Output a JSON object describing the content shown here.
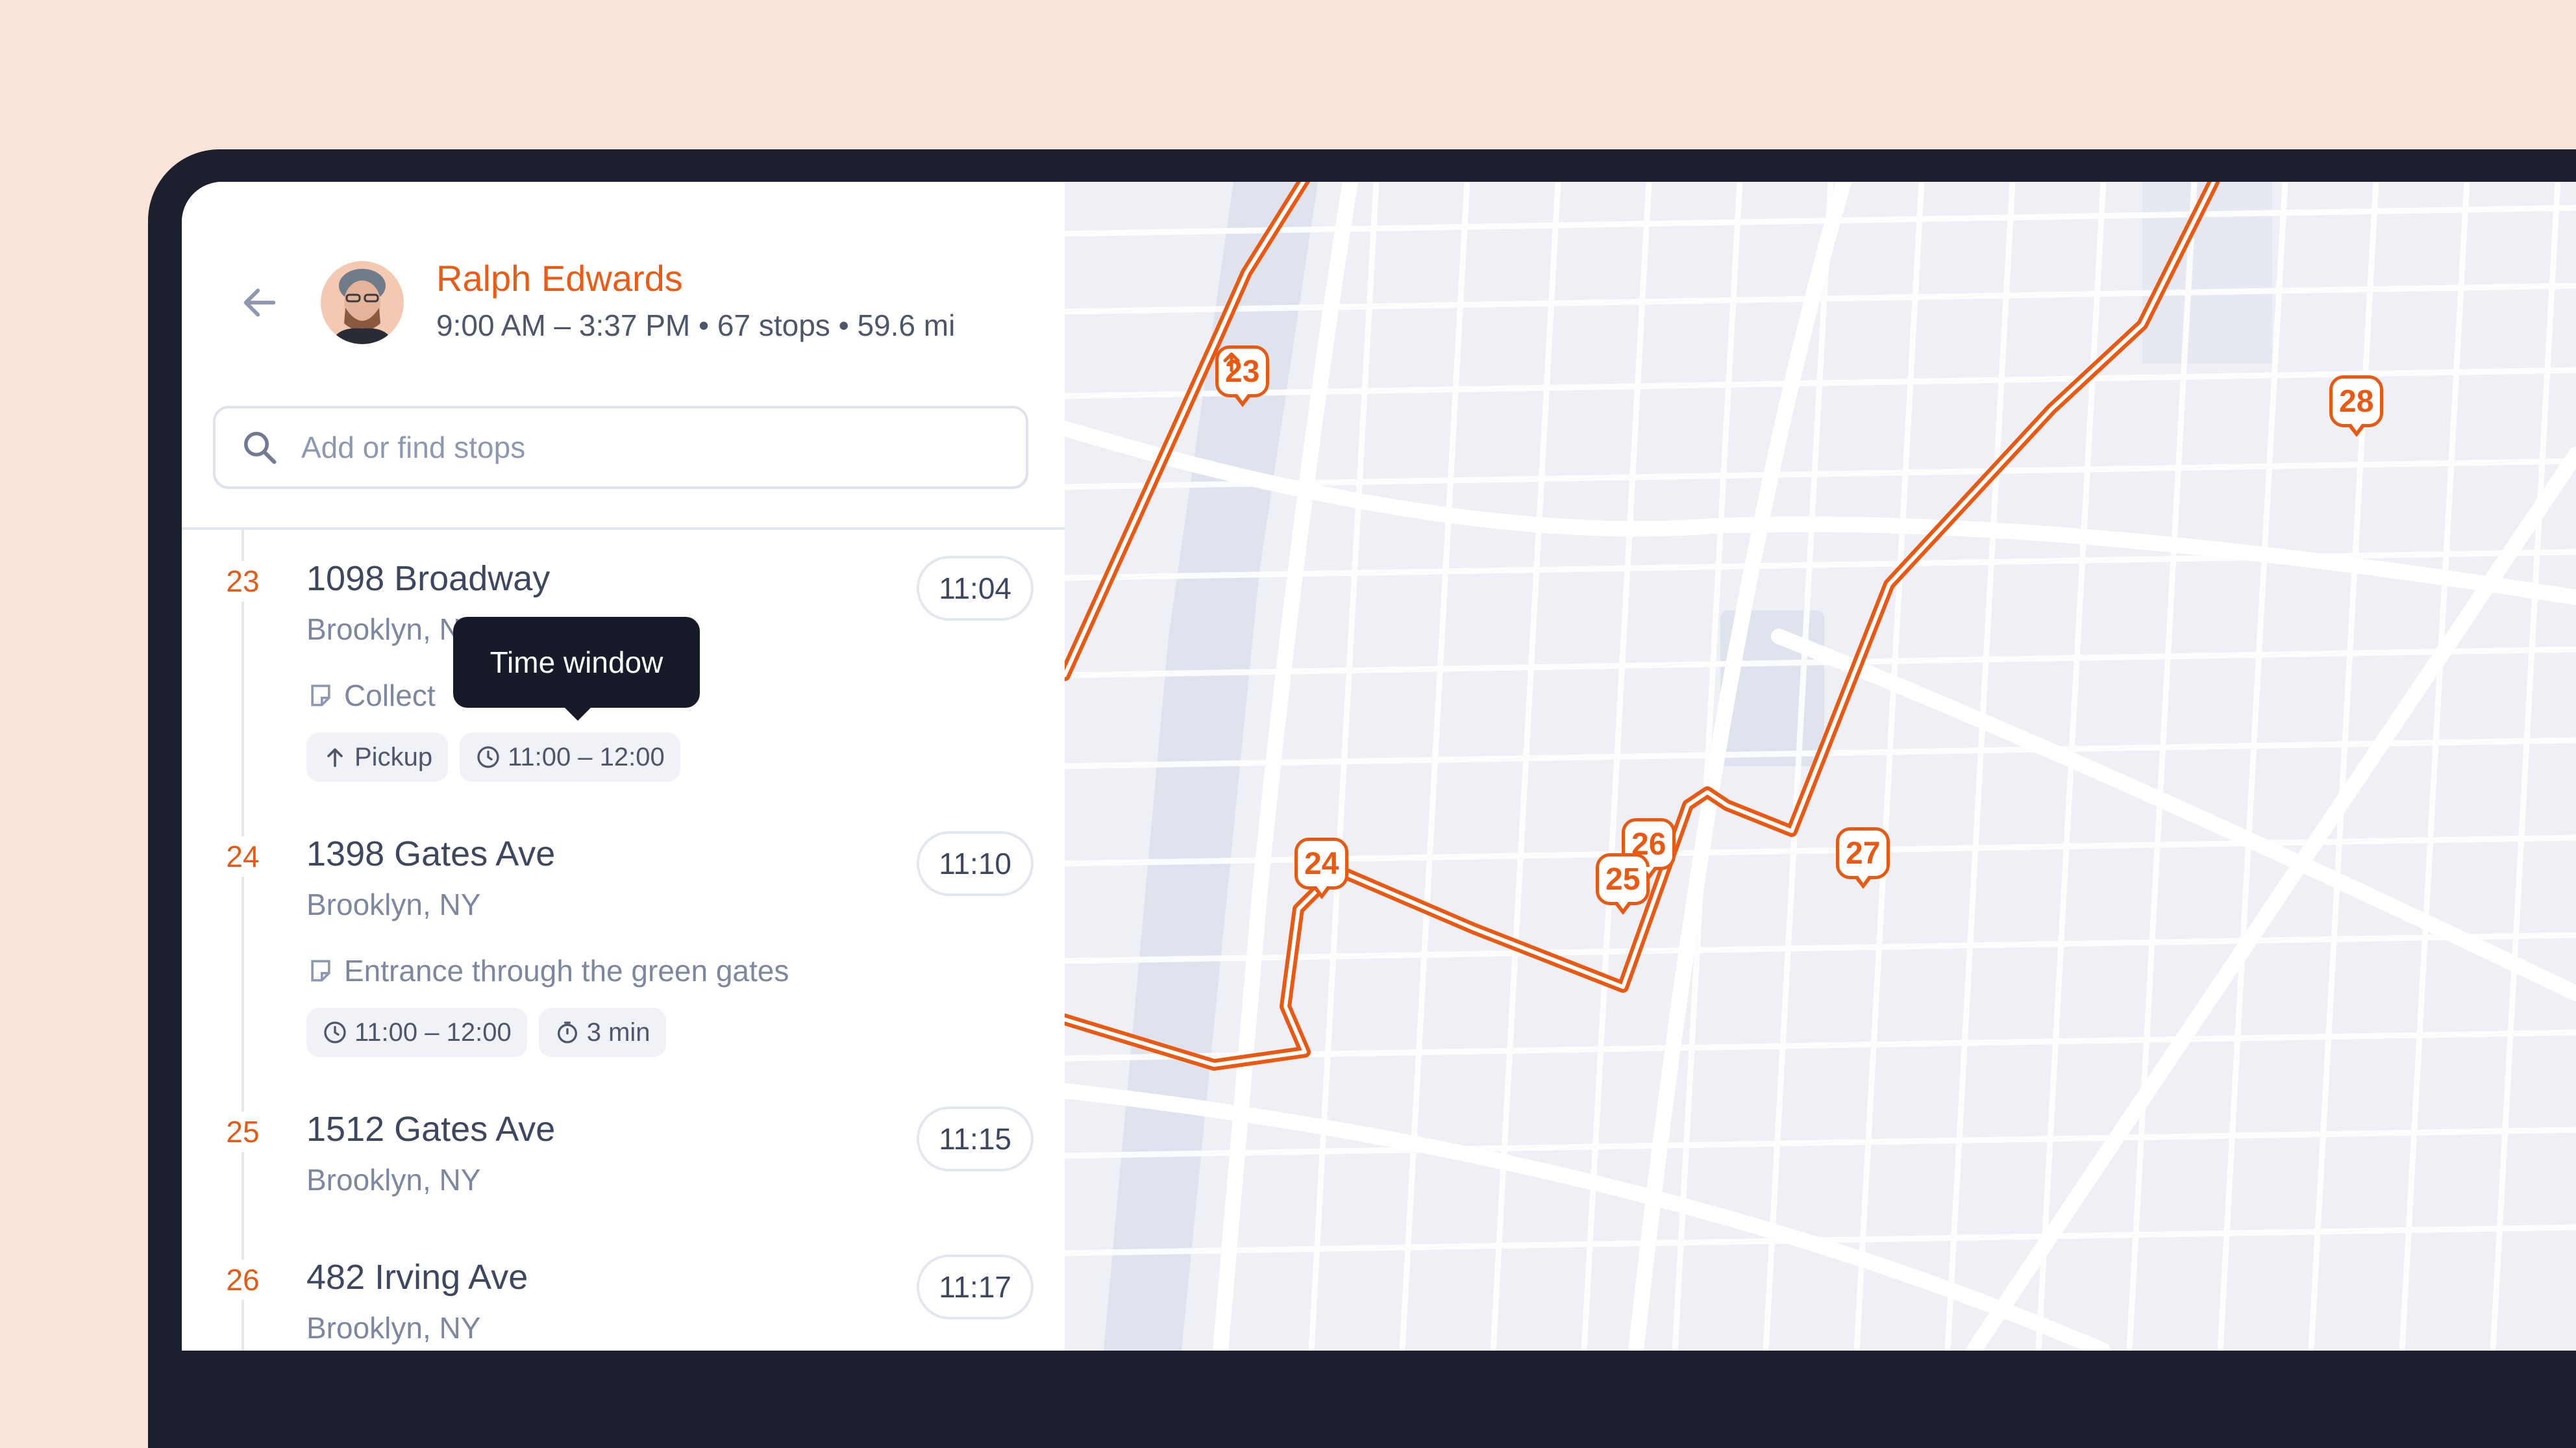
{
  "driver": {
    "name": "Ralph Edwards",
    "summary": "9:00 AM – 3:37 PM • 67 stops • 59.6 mi"
  },
  "search": {
    "placeholder": "Add or find stops"
  },
  "tooltip": {
    "text": "Time window"
  },
  "stops": [
    {
      "number": "23",
      "address": "1098 Broadway",
      "city": "Brooklyn, N",
      "note": "Collect",
      "time": "11:04",
      "chips": [
        {
          "icon": "arrow-up-icon",
          "label": "Pickup"
        },
        {
          "icon": "clock-icon",
          "label": "11:00 – 12:00"
        }
      ]
    },
    {
      "number": "24",
      "address": "1398 Gates Ave",
      "city": "Brooklyn, NY",
      "note": "Entrance through the green gates",
      "time": "11:10",
      "chips": [
        {
          "icon": "clock-icon",
          "label": "11:00 – 12:00"
        },
        {
          "icon": "stopwatch-icon",
          "label": "3 min"
        }
      ]
    },
    {
      "number": "25",
      "address": "1512 Gates Ave",
      "city": "Brooklyn, NY",
      "time": "11:15"
    },
    {
      "number": "26",
      "address": "482 Irving Ave",
      "city": "Brooklyn, NY",
      "time": "11:17"
    }
  ],
  "map": {
    "pins": [
      {
        "label": "23",
        "icon": "arrow-up-icon"
      },
      {
        "label": "24"
      },
      {
        "label": "25"
      },
      {
        "label": "26"
      },
      {
        "label": "27"
      },
      {
        "label": "28"
      }
    ],
    "route_color": "#e85a13"
  },
  "colors": {
    "accent": "#ec5a13",
    "background": "#fbe5da",
    "frame": "#1b1f2e"
  }
}
